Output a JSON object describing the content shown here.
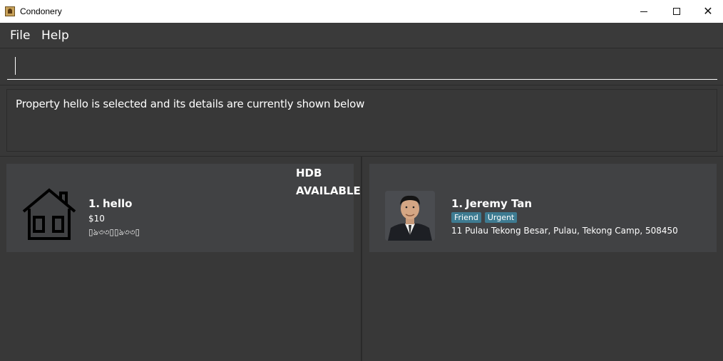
{
  "window": {
    "title": "Condonery",
    "minimize_glyph": "—",
    "maximize_glyph": "☐",
    "close_glyph": "✕"
  },
  "menu": {
    "items": [
      {
        "label": "File"
      },
      {
        "label": "Help"
      }
    ]
  },
  "command_box": {
    "value": "",
    "placeholder": ""
  },
  "result_display": {
    "message": "Property hello is selected and its details are currently shown below"
  },
  "property_list": {
    "items": [
      {
        "index": "1.",
        "name": "hello",
        "price": "$10",
        "garbled_text": "▯ঌ৩৩▯▯ঌ৩৩▯",
        "type": "HDB",
        "status": "AVAILABLE",
        "icon": "house-icon"
      }
    ]
  },
  "person_list": {
    "items": [
      {
        "index": "1.",
        "name": "Jeremy Tan",
        "tags": [
          "Friend",
          "Urgent"
        ],
        "address": "11 Pulau Tekong Besar, Pulau, Tekong Camp, 508450",
        "icon": "avatar-photo"
      }
    ]
  },
  "colors": {
    "background": "#333333",
    "card": "#414244",
    "tag": "#3e7b91",
    "text": "#ffffff"
  }
}
